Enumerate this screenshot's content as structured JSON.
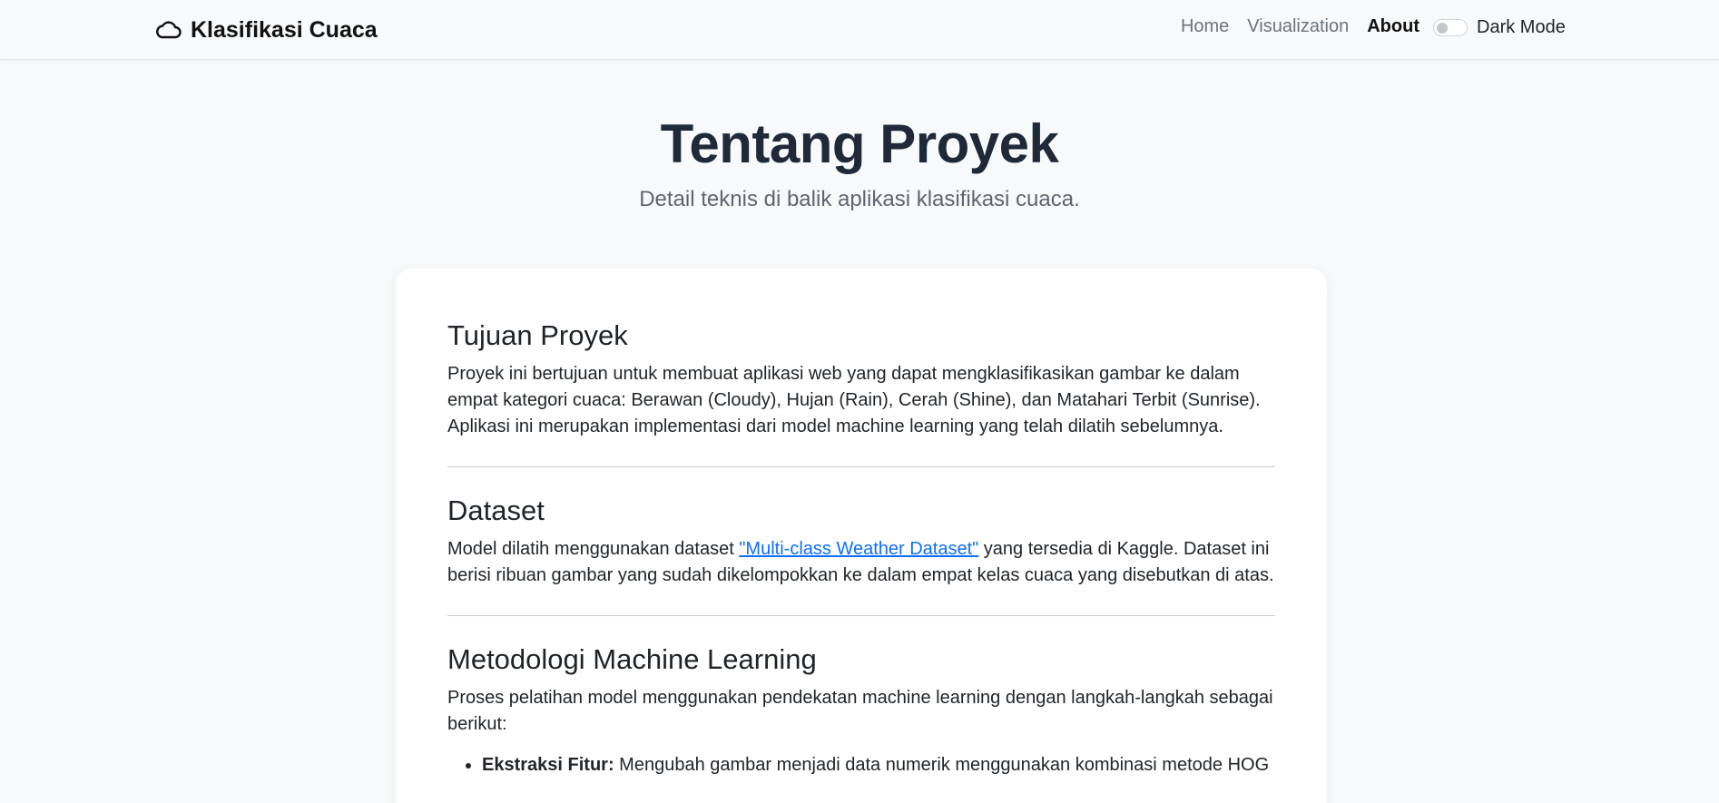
{
  "navbar": {
    "brand": "Klasifikasi Cuaca",
    "brand_icon": "cloud-icon",
    "links": [
      {
        "label": "Home",
        "active": false
      },
      {
        "label": "Visualization",
        "active": false
      },
      {
        "label": "About",
        "active": true
      }
    ],
    "dark_mode_label": "Dark Mode",
    "dark_mode_on": false
  },
  "hero": {
    "title": "Tentang Proyek",
    "subtitle": "Detail teknis di balik aplikasi klasifikasi cuaca."
  },
  "sections": {
    "goal": {
      "heading": "Tujuan Proyek",
      "text": "Proyek ini bertujuan untuk membuat aplikasi web yang dapat mengklasifikasikan gambar ke dalam empat kategori cuaca: Berawan (Cloudy), Hujan (Rain), Cerah (Shine), dan Matahari Terbit (Sunrise). Aplikasi ini merupakan implementasi dari model machine learning yang telah dilatih sebelumnya."
    },
    "dataset": {
      "heading": "Dataset",
      "text_before": "Model dilatih menggunakan dataset ",
      "link": "\"Multi-class Weather Dataset\"",
      "text_after": " yang tersedia di Kaggle. Dataset ini berisi ribuan gambar yang sudah dikelompokkan ke dalam empat kelas cuaca yang disebutkan di atas."
    },
    "method": {
      "heading": "Metodologi Machine Learning",
      "text": "Proses pelatihan model menggunakan pendekatan machine learning dengan langkah-langkah sebagai berikut:",
      "items": [
        {
          "title": "Ekstraksi Fitur:",
          "text": " Mengubah gambar menjadi data numerik menggunakan kombinasi metode HOG"
        }
      ]
    }
  },
  "colors": {
    "accent_link": "#0d6efd",
    "background": "#f8f9fa"
  }
}
